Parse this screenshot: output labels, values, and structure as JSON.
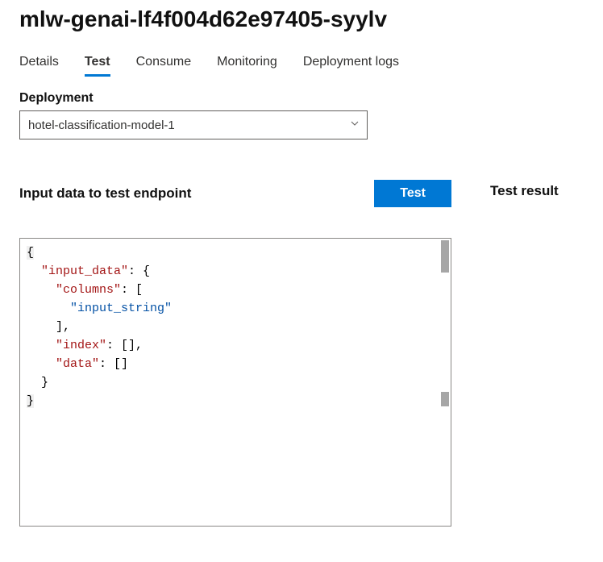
{
  "title": "mlw-genai-lf4f004d62e97405-syylv",
  "tabs": [
    {
      "label": "Details",
      "active": false
    },
    {
      "label": "Test",
      "active": true
    },
    {
      "label": "Consume",
      "active": false
    },
    {
      "label": "Monitoring",
      "active": false
    },
    {
      "label": "Deployment logs",
      "active": false
    }
  ],
  "deployment": {
    "label": "Deployment",
    "selected": "hotel-classification-model-1"
  },
  "left": {
    "heading": "Input data to test endpoint",
    "test_button": "Test"
  },
  "right": {
    "heading": "Test result"
  },
  "editor": {
    "tokens": [
      [
        {
          "cls": "t-brace",
          "txt": "{"
        }
      ],
      [
        {
          "cls": "indent",
          "txt": "  "
        },
        {
          "cls": "t-key",
          "txt": "\"input_data\""
        },
        {
          "cls": "t-punc",
          "txt": ": {"
        }
      ],
      [
        {
          "cls": "indent",
          "txt": "    "
        },
        {
          "cls": "t-key",
          "txt": "\"columns\""
        },
        {
          "cls": "t-punc",
          "txt": ": ["
        }
      ],
      [
        {
          "cls": "indent",
          "txt": "      "
        },
        {
          "cls": "t-str",
          "txt": "\"input_string\""
        }
      ],
      [
        {
          "cls": "indent",
          "txt": "    "
        },
        {
          "cls": "t-punc",
          "txt": "],"
        }
      ],
      [
        {
          "cls": "indent",
          "txt": "    "
        },
        {
          "cls": "t-key",
          "txt": "\"index\""
        },
        {
          "cls": "t-punc",
          "txt": ": [],"
        }
      ],
      [
        {
          "cls": "indent",
          "txt": "    "
        },
        {
          "cls": "t-key",
          "txt": "\"data\""
        },
        {
          "cls": "t-punc",
          "txt": ": []"
        }
      ],
      [
        {
          "cls": "indent",
          "txt": "  "
        },
        {
          "cls": "t-punc",
          "txt": "}"
        }
      ],
      [
        {
          "cls": "t-brace",
          "txt": "}"
        }
      ]
    ]
  }
}
